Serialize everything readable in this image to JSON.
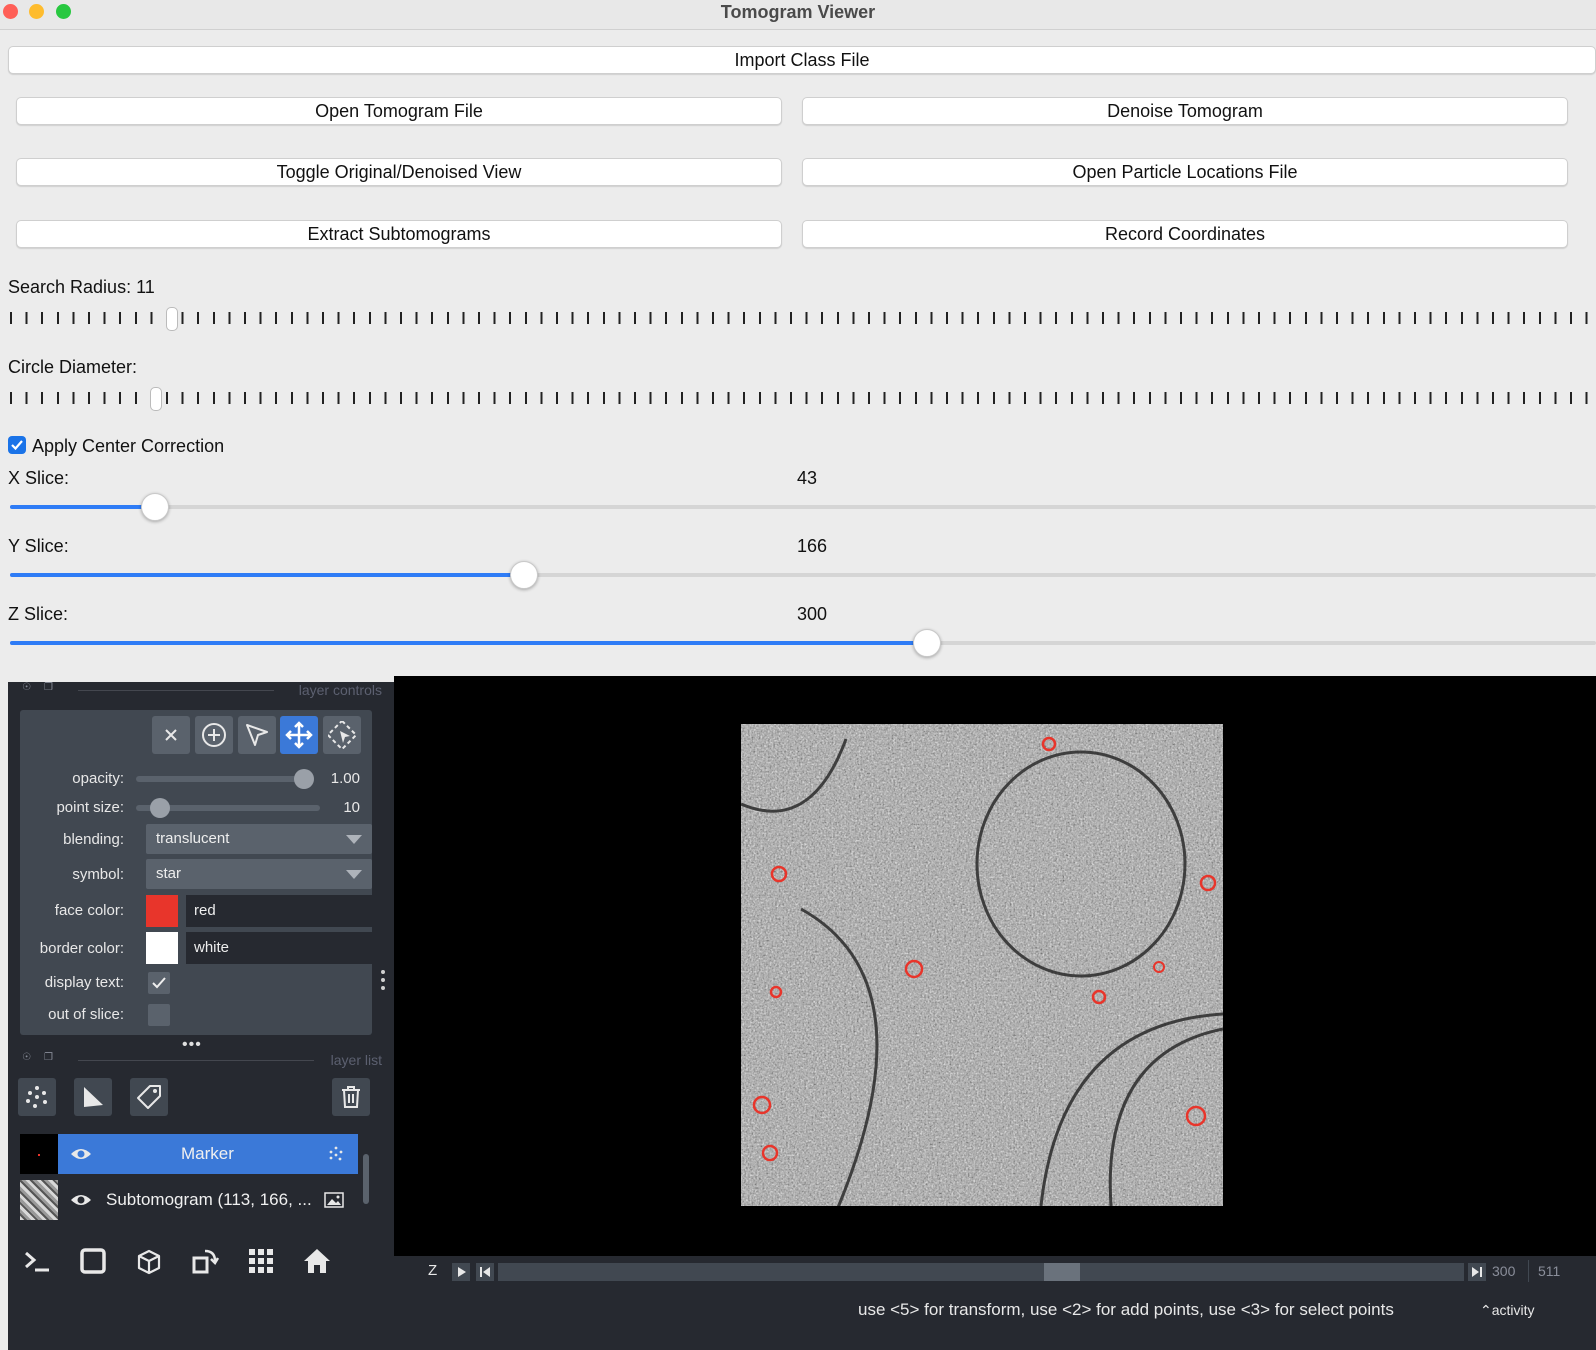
{
  "window": {
    "title": "Tomogram Viewer"
  },
  "buttons": {
    "import_class": "Import Class File",
    "open_tomogram": "Open Tomogram File",
    "denoise": "Denoise Tomogram",
    "toggle_view": "Toggle Original/Denoised View",
    "open_particles": "Open Particle Locations File",
    "extract": "Extract Subtomograms",
    "record": "Record Coordinates"
  },
  "search_radius": {
    "label": "Search Radius: 11",
    "value": 11
  },
  "circle_diameter": {
    "label": "Circle Diameter:"
  },
  "center_correction": {
    "label": "Apply Center Correction",
    "checked": true
  },
  "slices": {
    "x": {
      "label": "X Slice:",
      "value": "43",
      "fraction": 0.0915
    },
    "y": {
      "label": "Y Slice:",
      "value": "166",
      "fraction": 0.324
    },
    "z": {
      "label": "Z Slice:",
      "value": "300",
      "fraction": 0.578
    }
  },
  "napari": {
    "layer_controls_title": "layer controls",
    "layer_list_title": "layer list",
    "modes": [
      "close-icon",
      "add-points-icon",
      "select-icon",
      "pan-zoom-icon",
      "transform-icon"
    ],
    "active_mode": "pan-zoom-icon",
    "controls": {
      "opacity_label": "opacity:",
      "opacity_value": "1.00",
      "opacity_fraction": 1.0,
      "point_size_label": "point size:",
      "point_size_value": "10",
      "point_size_fraction": 0.13,
      "blending_label": "blending:",
      "blending_value": "translucent",
      "symbol_label": "symbol:",
      "symbol_value": "star",
      "face_color_label": "face color:",
      "face_color_value": "red",
      "face_color_hex": "#e8352b",
      "border_color_label": "border color:",
      "border_color_value": "white",
      "border_color_hex": "#ffffff",
      "display_text_label": "display text:",
      "display_text_checked": true,
      "out_of_slice_label": "out of slice:",
      "out_of_slice_checked": false
    },
    "layers": [
      {
        "name": "Marker",
        "selected": true,
        "type": "points"
      },
      {
        "name": "Subtomogram (113, 166, ...",
        "selected": false,
        "type": "image"
      }
    ],
    "dims": {
      "axis": "Z",
      "current": "300",
      "max": "511",
      "fraction": 0.587
    },
    "status": "use <5> for transform, use <2> for add points, use <3> for select points",
    "activity": "activity"
  },
  "colors": {
    "accent": "#2e7cf6",
    "napari_bg": "#262930",
    "napari_panel": "#414851",
    "napari_active": "#3b79d8",
    "marker": "#e8352b"
  }
}
